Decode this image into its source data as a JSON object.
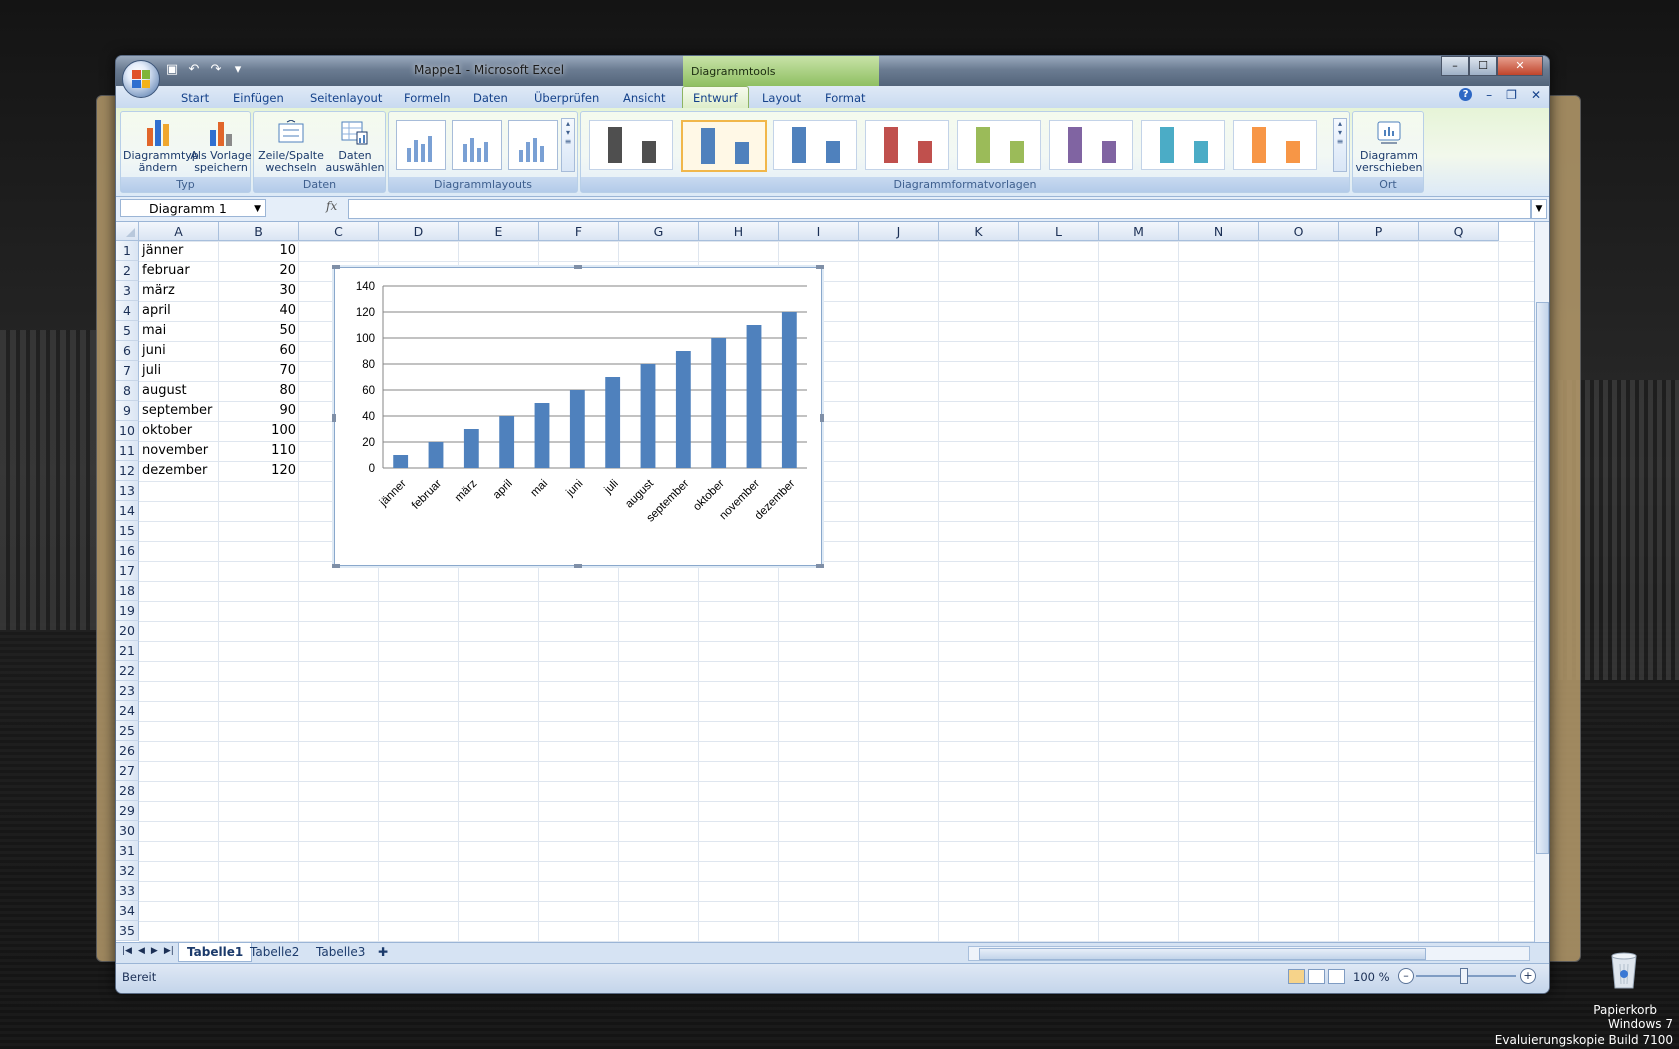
{
  "window": {
    "title": "Mappe1 - Microsoft Excel",
    "context_title": "Diagrammtools",
    "controls": [
      "–",
      "☐",
      "✕"
    ]
  },
  "tabs": [
    "Start",
    "Einfügen",
    "Seitenlayout",
    "Formeln",
    "Daten",
    "Überprüfen",
    "Ansicht",
    "Entwurf",
    "Layout",
    "Format"
  ],
  "active_tab": "Entwurf",
  "ribbon": {
    "groups": {
      "typ": {
        "label": "Typ",
        "btn1": {
          "line1": "Diagrammtyp",
          "line2": "ändern"
        },
        "btn2": {
          "line1": "Als Vorlage",
          "line2": "speichern"
        }
      },
      "daten": {
        "label": "Daten",
        "btn1": {
          "line1": "Zeile/Spalte",
          "line2": "wechseln"
        },
        "btn2": {
          "line1": "Daten",
          "line2": "auswählen"
        }
      },
      "layouts": {
        "label": "Diagrammlayouts"
      },
      "styles": {
        "label": "Diagrammformatvorlagen",
        "colors": [
          "#4f4f4f",
          "#4f81bd",
          "#4f81bd",
          "#c0504d",
          "#9bbb59",
          "#8064a2",
          "#4bacc6",
          "#f79646"
        ],
        "selected_index": 1
      },
      "ort": {
        "label": "Ort",
        "btn1": {
          "line1": "Diagramm",
          "line2": "verschieben"
        }
      }
    }
  },
  "formula_bar": {
    "name_box": "Diagramm 1",
    "fx": "fx",
    "formula": ""
  },
  "columns": [
    "A",
    "B",
    "C",
    "D",
    "E",
    "F",
    "G",
    "H",
    "I",
    "J",
    "K",
    "L",
    "M",
    "N",
    "O",
    "P",
    "Q"
  ],
  "rows": [
    "1",
    "2",
    "3",
    "4",
    "5",
    "6",
    "7",
    "8",
    "9",
    "10",
    "11",
    "12",
    "13",
    "14",
    "15",
    "16",
    "17",
    "18",
    "19",
    "20",
    "21",
    "22",
    "23",
    "24",
    "25",
    "26",
    "27",
    "28",
    "29",
    "30",
    "31",
    "32",
    "33",
    "34",
    "35"
  ],
  "cells": {
    "A": [
      "jänner",
      "februar",
      "märz",
      "april",
      "mai",
      "juni",
      "juli",
      "august",
      "september",
      "oktober",
      "november",
      "dezember"
    ],
    "B": [
      "10",
      "20",
      "30",
      "40",
      "50",
      "60",
      "70",
      "80",
      "90",
      "100",
      "110",
      "120"
    ]
  },
  "chart_data": {
    "type": "bar",
    "categories": [
      "jänner",
      "februar",
      "märz",
      "april",
      "mai",
      "juni",
      "juli",
      "august",
      "september",
      "oktober",
      "november",
      "dezember"
    ],
    "values": [
      10,
      20,
      30,
      40,
      50,
      60,
      70,
      80,
      90,
      100,
      110,
      120
    ],
    "title": "",
    "xlabel": "",
    "ylabel": "",
    "ylim": [
      0,
      140
    ],
    "yticks": [
      "0",
      "20",
      "40",
      "60",
      "80",
      "100",
      "120",
      "140"
    ],
    "grid": true,
    "legend": "none",
    "color": "#4f81bd"
  },
  "sheets": [
    "Tabelle1",
    "Tabelle2",
    "Tabelle3"
  ],
  "active_sheet": "Tabelle1",
  "status": {
    "text": "Bereit",
    "zoom": "100 %",
    "zoom_minus": "–",
    "zoom_plus": "+"
  },
  "desktop": {
    "recycle_label": "Papierkorb",
    "os_line1": "Windows 7",
    "os_line2": "Evaluierungskopie Build 7100"
  }
}
